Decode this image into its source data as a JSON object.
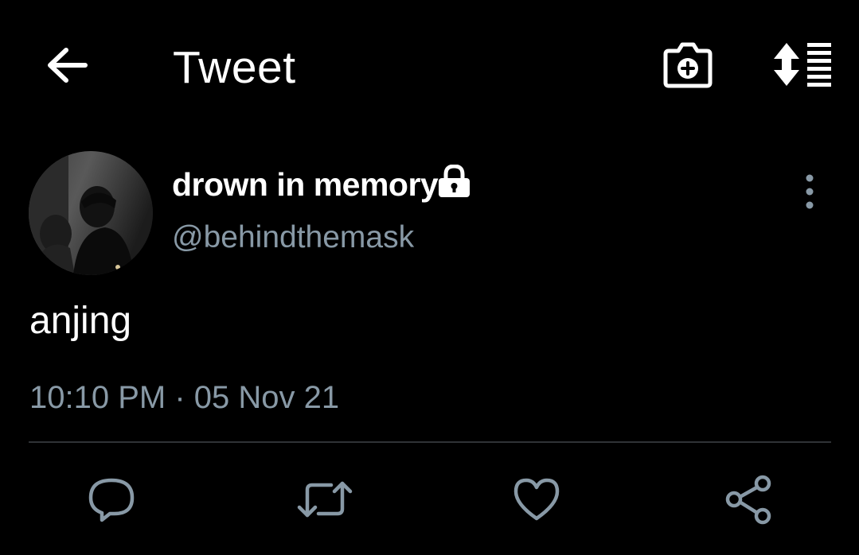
{
  "header": {
    "title": "Tweet",
    "back_icon": "arrow-left-icon",
    "camera_icon": "camera-plus-icon",
    "sort_icon": "sort-list-icon"
  },
  "tweet": {
    "display_name": "drown in memory",
    "handle": "@behindthemask",
    "protected": true,
    "text": "anjing",
    "timestamp": "10:10 PM · 05 Nov 21"
  },
  "actions": [
    {
      "name": "reply",
      "icon": "reply-icon"
    },
    {
      "name": "retweet",
      "icon": "retweet-icon"
    },
    {
      "name": "like",
      "icon": "heart-icon"
    },
    {
      "name": "share",
      "icon": "share-icon"
    }
  ],
  "colors": {
    "background": "#000000",
    "primary_text": "#ffffff",
    "secondary_text": "#8899a6",
    "divider": "#2f3336"
  }
}
